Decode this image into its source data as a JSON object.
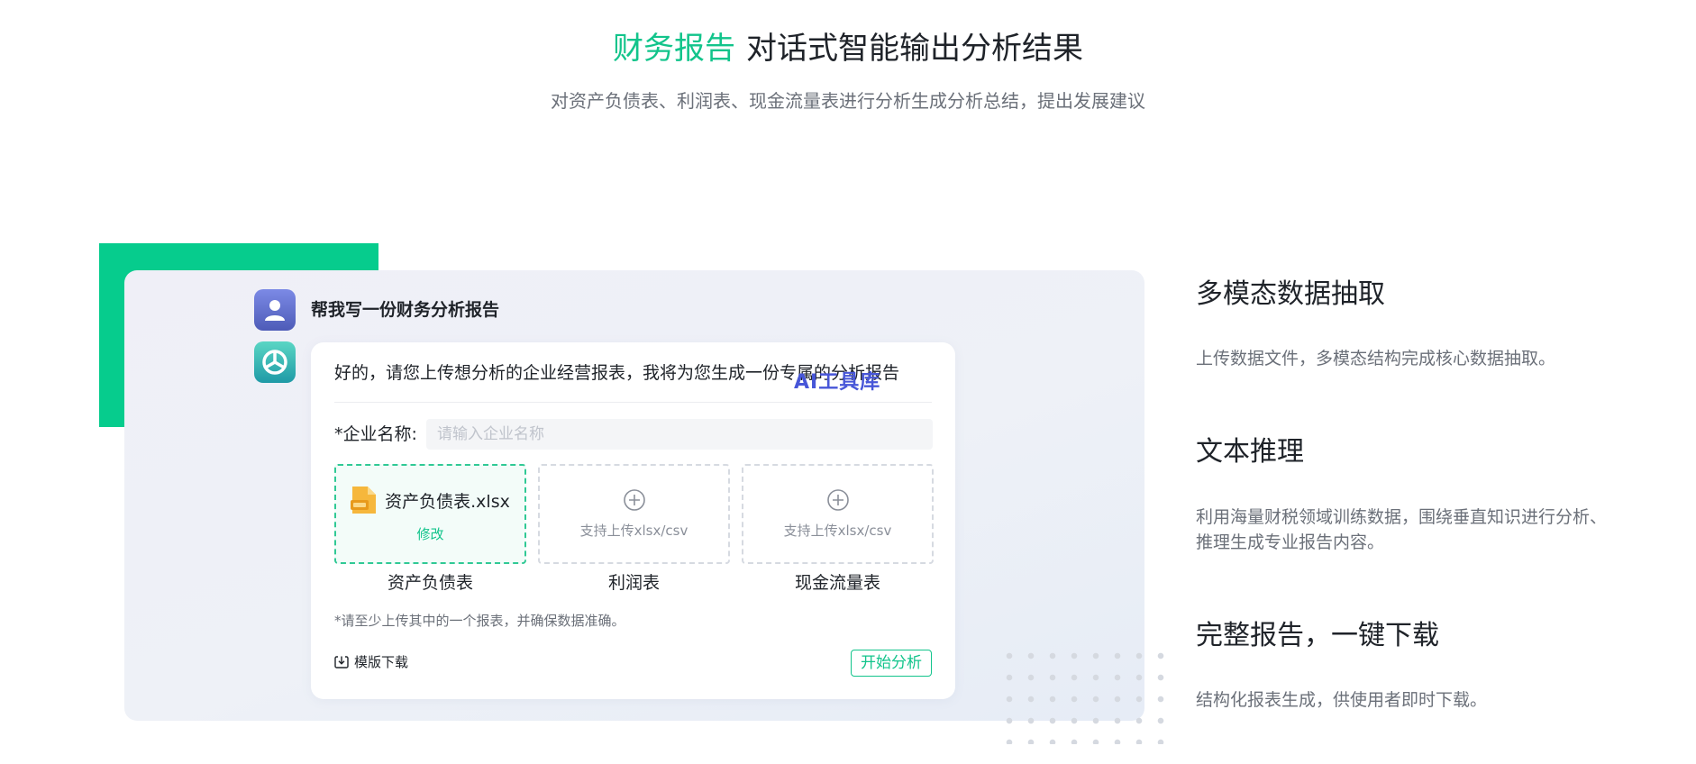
{
  "hero": {
    "title_accent": "财务报告",
    "title_rest": "对话式智能输出分析结果",
    "subtitle": "对资产负债表、利润表、现金流量表进行分析生成分析总结，提出发展建议"
  },
  "chat": {
    "user_message": "帮我写一份财务分析报告",
    "bot_message": "好的，请您上传想分析的企业经营报表，我将为您生成一份专属的分析报告",
    "watermark": "AI工具库",
    "company_label": "*企业名称:",
    "company_placeholder": "请输入企业名称",
    "uploads": [
      {
        "file_name": "资产负债表.xlsx",
        "action": "修改",
        "caption": "资产负债表"
      },
      {
        "hint": "支持上传xlsx/csv",
        "caption": "利润表"
      },
      {
        "hint": "支持上传xlsx/csv",
        "caption": "现金流量表"
      }
    ],
    "note": "*请至少上传其中的一个报表，并确保数据准确。",
    "template_download": "模版下载",
    "start_button": "开始分析"
  },
  "features": [
    {
      "title": "多模态数据抽取",
      "desc": "上传数据文件，多模态结构完成核心数据抽取。"
    },
    {
      "title": "文本推理",
      "desc": "利用海量财税领域训练数据，围绕垂直知识进行分析、推理生成专业报告内容。"
    },
    {
      "title": "完整报告，一键下载",
      "desc": "结构化报表生成，供使用者即时下载。"
    }
  ],
  "icons": {
    "user_avatar": "user-icon",
    "bot_avatar": "bot-logo-icon",
    "file": "excel-file-icon",
    "upload": "plus-circle-icon",
    "download": "download-icon"
  },
  "colors": {
    "accent": "#12c48b",
    "green_block": "#06cc8d",
    "watermark": "#4756d8"
  }
}
